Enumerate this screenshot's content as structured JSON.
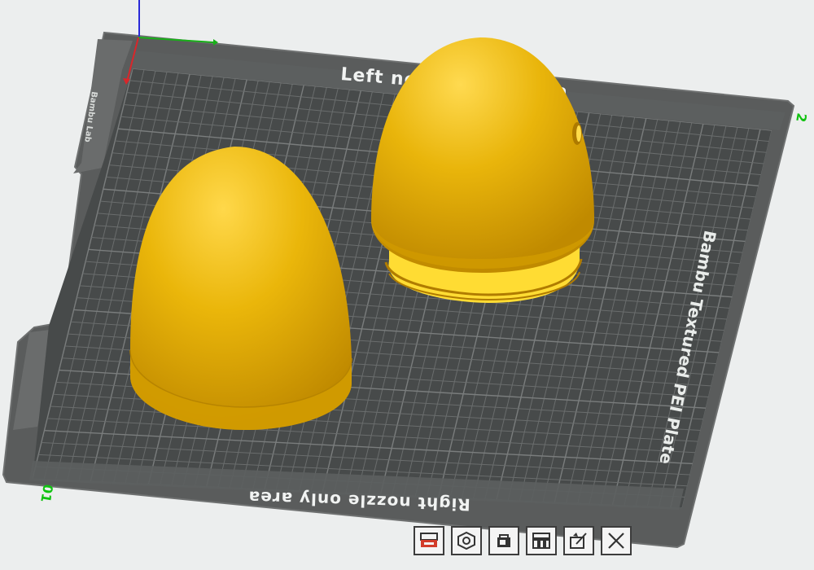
{
  "plate": {
    "top_label": "Left nozzle only area",
    "bottom_label": "Right nozzle only area",
    "plate_name": "Bambu Textured PEI Plate",
    "plate_number": "01",
    "corner_number": "2",
    "side_badge": "Bambu Lab"
  },
  "colors": {
    "plate_frame": "#5a5c5c",
    "plate_surface": "#474a4a",
    "grid_line": "#6a6d6d",
    "model_yellow": "#ecb80c",
    "axis_x": "#d9262a",
    "axis_y": "#18b018",
    "axis_z": "#2a2ad8",
    "background": "#eceeee"
  },
  "toolbar": {
    "buttons": [
      {
        "name": "plate-setting-button",
        "icon": "printer-icon"
      },
      {
        "name": "auto-orient-button",
        "icon": "hexagon-nut-icon"
      },
      {
        "name": "lock-plate-button",
        "icon": "lock-icon"
      },
      {
        "name": "arrange-plate-button",
        "icon": "arrange-grid-icon"
      },
      {
        "name": "edit-plate-button",
        "icon": "edit-settings-icon"
      },
      {
        "name": "remove-plate-button",
        "icon": "close-icon"
      }
    ]
  }
}
